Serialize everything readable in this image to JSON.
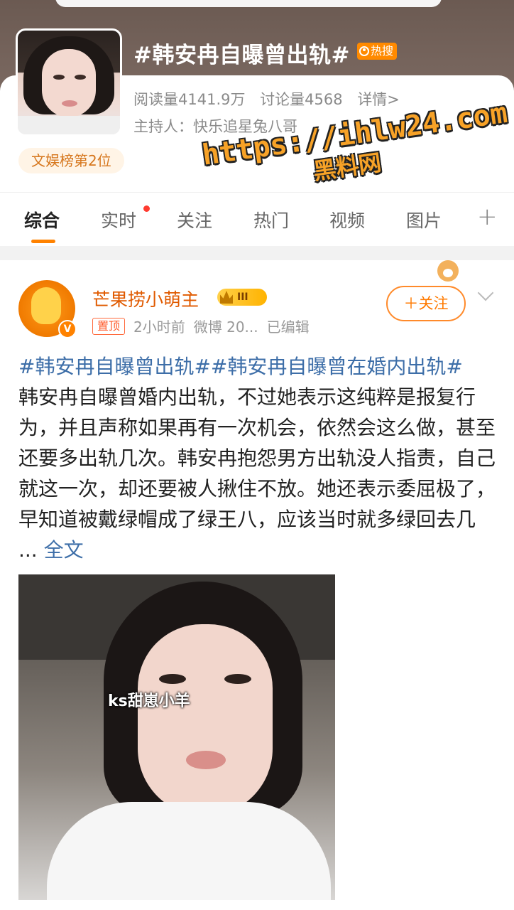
{
  "topic": {
    "title": "#韩安冉自曝曾出轨#",
    "hot_badge": "热搜",
    "reads": "阅读量4141.9万",
    "discussions": "讨论量4568",
    "details_link": "详情>",
    "host": "主持人：快乐追星兔八哥",
    "rank": "文娱榜第2位"
  },
  "watermark": {
    "line1": "https://ihlw24.com",
    "line2": "黑料网"
  },
  "tabs": [
    {
      "label": "综合",
      "active": true
    },
    {
      "label": "实时",
      "active": false
    },
    {
      "label": "关注",
      "active": false
    },
    {
      "label": "热门",
      "active": false
    },
    {
      "label": "视频",
      "active": false
    },
    {
      "label": "图片",
      "active": false
    }
  ],
  "tabs_more": "+",
  "post": {
    "author": "芒果捞小萌主",
    "level": "III",
    "pinned": "置顶",
    "time": "2小时前",
    "source": "微博 20...",
    "edited": "已编辑",
    "follow": "＋关注",
    "hashtags": "#韩安冉自曝曾出轨##韩安冉自曝曾在婚内出轨#",
    "body": "韩安冉自曝曾婚内出轨，不过她表示这纯粹是报复行为，并且声称如果再有一次机会，依然会这么做，甚至还要多出轨几次。韩安冉抱怨男方出轨没人指责，自己就这一次，却还要被人揪住不放。她还表示委屈极了，早知道被戴绿帽成了绿王八，应该当时就多绿回去几 ...",
    "more": "全文",
    "video_caption": "ks甜崽小羊"
  },
  "colors": {
    "accent": "#ff8200",
    "link": "#3d6ea8",
    "author": "#e05a00"
  }
}
